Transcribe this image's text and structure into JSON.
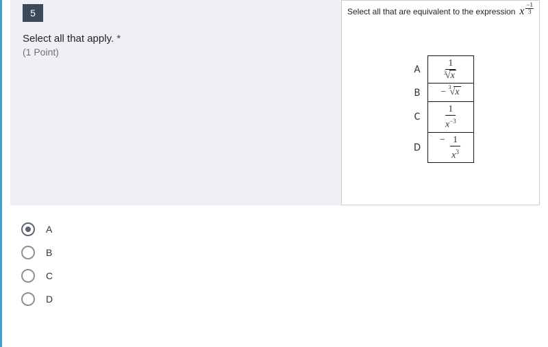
{
  "question": {
    "number": "5",
    "instruction": "Select all that apply.",
    "required_marker": "*",
    "points": "(1 Point)",
    "prompt_prefix": "Select all that are equivalent to the expression",
    "expression": {
      "base": "x",
      "exp_sign": "−",
      "exp_num": "1",
      "exp_den": "3"
    }
  },
  "choices": {
    "A": {
      "type": "frac",
      "num": "1",
      "den_root_index": "3",
      "den_root_radicand": "x"
    },
    "B": {
      "type": "neg_root",
      "sign": "−",
      "root_index": "3",
      "root_radicand": "x"
    },
    "C": {
      "type": "frac_power",
      "num": "1",
      "den_base": "x",
      "den_exp": "−3"
    },
    "D": {
      "type": "neg_frac_power",
      "sign": "−",
      "num": "1",
      "den_base": "x",
      "den_exp": "3"
    }
  },
  "options": [
    {
      "label": "A",
      "selected": true
    },
    {
      "label": "B",
      "selected": false
    },
    {
      "label": "C",
      "selected": false
    },
    {
      "label": "D",
      "selected": false
    }
  ]
}
